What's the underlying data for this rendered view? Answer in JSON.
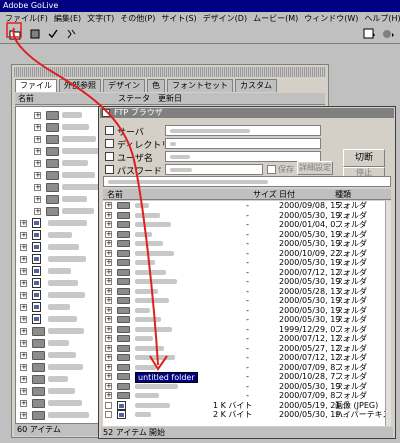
{
  "app": {
    "title": "Adobe GoLive"
  },
  "menu": [
    "ファイル(F)",
    "編集(E)",
    "文字(T)",
    "その他(P)",
    "サイト(S)",
    "デザイン(D)",
    "ムービー(M)",
    "ウィンドウ(W)",
    "ヘルプ(H)"
  ],
  "toolbar": {
    "icons": [
      "new-folder-icon",
      "open-icon",
      "check-icon",
      "link-icon"
    ]
  },
  "site_window": {
    "tabs": [
      "ファイル",
      "外部参照",
      "デザイン",
      "色",
      "フォントセット",
      "カスタム"
    ],
    "columns": [
      "名前",
      "ステータス",
      "更新日"
    ],
    "status": "60 アイテム"
  },
  "ftp": {
    "title": "FTP ブラウザ",
    "labels": {
      "server": "サーバ",
      "directory": "ディレクトリ",
      "user": "ユーザ名",
      "password": "パスワード",
      "save": "保存"
    },
    "buttons": {
      "connect": "切断",
      "advanced": "詳細設定",
      "stop": "停止"
    },
    "columns": {
      "name": "名前",
      "size": "サイズ",
      "date": "日付",
      "kind": "種類"
    },
    "rows": [
      {
        "size": "-",
        "date": "2000/09/08, 15...",
        "kind": "フォルダ"
      },
      {
        "size": "-",
        "date": "2000/05/30, 19...",
        "kind": "フォルダ"
      },
      {
        "size": "-",
        "date": "2000/01/04, 0...",
        "kind": "フォルダ"
      },
      {
        "size": "-",
        "date": "2000/05/30, 19...",
        "kind": "フォルダ"
      },
      {
        "size": "-",
        "date": "2000/05/30, 19...",
        "kind": "フォルダ"
      },
      {
        "size": "-",
        "date": "2000/10/09, 22...",
        "kind": "フォルダ"
      },
      {
        "size": "-",
        "date": "2000/05/30, 19...",
        "kind": "フォルダ"
      },
      {
        "size": "-",
        "date": "2000/07/12, 12...",
        "kind": "フォルダ"
      },
      {
        "size": "-",
        "date": "2000/05/30, 19...",
        "kind": "フォルダ"
      },
      {
        "size": "-",
        "date": "2000/05/28, 13...",
        "kind": "フォルダ"
      },
      {
        "size": "-",
        "date": "2000/05/30, 19...",
        "kind": "フォルダ"
      },
      {
        "size": "-",
        "date": "2000/05/30, 19...",
        "kind": "フォルダ"
      },
      {
        "size": "-",
        "date": "2000/05/30, 19...",
        "kind": "フォルダ"
      },
      {
        "size": "-",
        "date": "1999/12/29, 0...",
        "kind": "フォルダ"
      },
      {
        "size": "-",
        "date": "2000/07/12, 12...",
        "kind": "フォルダ"
      },
      {
        "size": "-",
        "date": "2000/05/27, 12...",
        "kind": "フォルダ"
      },
      {
        "size": "-",
        "date": "2000/07/12, 12...",
        "kind": "フォルダ"
      },
      {
        "size": "-",
        "date": "2000/07/09, 8...",
        "kind": "フォルダ"
      },
      {
        "size": "-",
        "date": "2000/10/28, 7...",
        "kind": "フォルダ",
        "name": "untitled folder",
        "selected": true
      },
      {
        "size": "-",
        "date": "2000/05/30, 19...",
        "kind": "フォルダ"
      },
      {
        "size": "-",
        "date": "2000/07/09, 8...",
        "kind": "フォルダ"
      },
      {
        "size": "1 K バイト",
        "date": "2000/05/19, 21...",
        "kind": "画像 (JPEG)"
      },
      {
        "size": "2 K バイト",
        "date": "2000/05/30, 19...",
        "kind": "ハイパーテキスト"
      }
    ],
    "status": {
      "count": "52 アイテム",
      "state": "開始"
    }
  },
  "colors": {
    "annotation": "#e02020",
    "title_active": "#000080",
    "title_inactive": "#808080",
    "selection": "#000080"
  }
}
